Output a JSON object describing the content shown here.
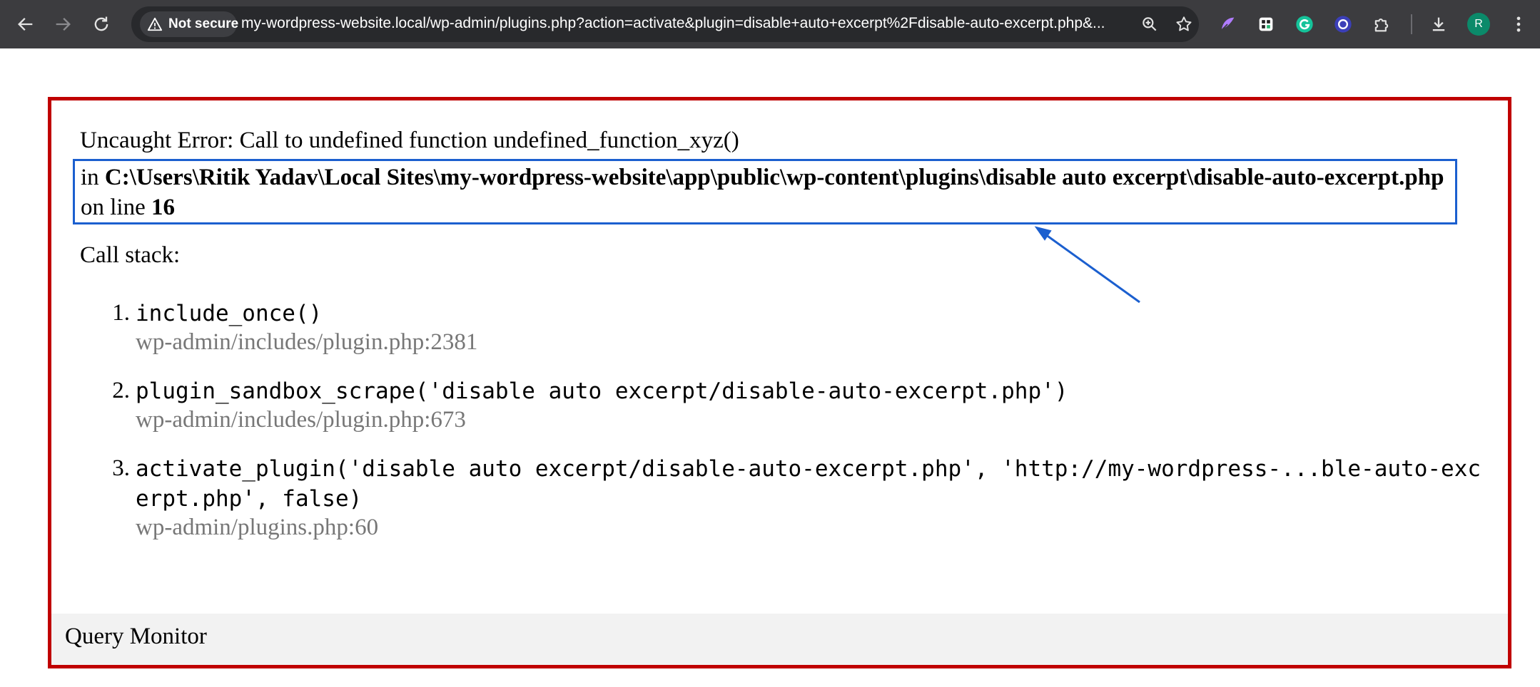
{
  "browser": {
    "security_label": "Not secure",
    "url": "my-wordpress-website.local/wp-admin/plugins.php?action=activate&plugin=disable+auto+excerpt%2Fdisable-auto-excerpt.php&...",
    "avatar_initial": "R",
    "colors": {
      "toolbar": "#3c3c3f",
      "omnibox": "#28292c",
      "avatar": "#0b8a6a"
    }
  },
  "error": {
    "title": "Uncaught Error: Call to undefined function undefined_function_xyz()",
    "location_prefix": "in ",
    "location_path": "C:\\Users\\Ritik Yadav\\Local Sites\\my-wordpress-website\\app\\public\\wp-content\\plugins\\disable auto excerpt\\disable-auto-excerpt.php",
    "location_mid": " on line ",
    "location_line": "16",
    "callstack_heading": "Call stack:",
    "stack": [
      {
        "num": "1.",
        "call": "include_once()",
        "file": "wp-admin/includes/plugin.php:2381"
      },
      {
        "num": "2.",
        "call": "plugin_sandbox_scrape('disable auto excerpt/disable-auto-excerpt.php')",
        "file": "wp-admin/includes/plugin.php:673"
      },
      {
        "num": "3.",
        "call": "activate_plugin('disable auto excerpt/disable-auto-excerpt.php', 'http://my-wordpress-...ble-auto-excerpt.php', false)",
        "file": "wp-admin/plugins.php:60"
      }
    ],
    "footer": "Query Monitor",
    "colors": {
      "panel_border": "#c00000",
      "highlight_border": "#1b5fcf",
      "file_text": "#777777"
    }
  }
}
